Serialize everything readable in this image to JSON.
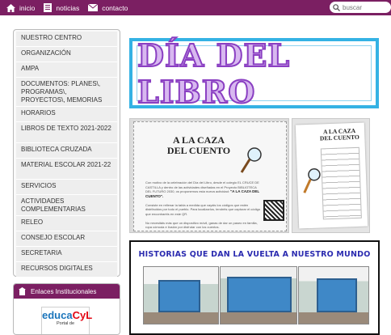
{
  "topnav": {
    "items": [
      {
        "label": "inicio",
        "icon": "home-icon"
      },
      {
        "label": "noticias",
        "icon": "news-icon"
      },
      {
        "label": "contacto",
        "icon": "mail-icon"
      }
    ],
    "search_placeholder": "buscar"
  },
  "colors": {
    "brand": "#7b1f62",
    "accent_blue": "#34b2e4",
    "title_purple": "#8a3fc2",
    "historias_blue": "#2b2bb0"
  },
  "menu": {
    "items": [
      "NUESTRO CENTRO",
      "ORGANIZACIÓN",
      "AMPA",
      "DOCUMENTOS: PLANES\\, PROGRAMAS\\, PROYECTOS\\, MEMORIAS",
      "HORARIOS",
      "LIBROS DE TEXTO 2021-2022",
      "BIBLIOTECA CRUZADA",
      "MATERIAL ESCOLAR 2021-22",
      "SERVICIOS",
      "ACTIVIDADES COMPLEMENTARIAS",
      "RELEO",
      "CONSEJO ESCOLAR",
      "SECRETARIA",
      "RECURSOS DIGITALES"
    ]
  },
  "enlaces": {
    "title": "Enlaces Institucionales",
    "logo_main": "educa",
    "logo_accent": "CyL",
    "logo_sub": "Portal de"
  },
  "banner": {
    "title": "DÍA DEL LIBRO"
  },
  "poster": {
    "title": "A LA CAZA DEL CUENTO",
    "body": "Con motivo de la celebración del Día del Libro, desde el colegio EL CRUCE DE CASTILLA y dentro de las actividades diseñadas en el Proyecto BIBLIOTECA DEL FUTURO 2030, os proponemos esta nueva actividad:",
    "highlight": "\"A LA CAZA DEL CUENTO\".",
    "body2": "Consiste en rellenar la tabla a medida que vayáis los códigos que estén distribuidos por todo el pueblo. Para localizarlos, tendréis que capturar el código que encontraréis en este QR.",
    "body3": "No necesitáis más que un dispositivo móvil, ganas de dar un paseo en familia, ropa cómoda e ilusión por disfrutar con los cuentos.",
    "sheet_title": "A LA CAZA DEL CUENTO"
  },
  "historias": {
    "title": "HISTORIAS QUE DAN LA VUELTA A NUESTRO MUNDO"
  }
}
